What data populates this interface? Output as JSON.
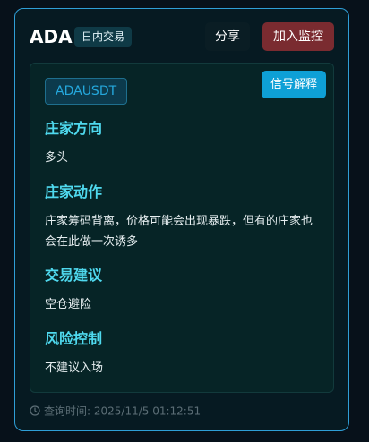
{
  "header": {
    "symbol": "ADA",
    "type_tag": "日内交易",
    "share_label": "分享",
    "monitor_label": "加入监控"
  },
  "panel": {
    "pair": "ADAUSDT",
    "explain_label": "信号解释",
    "sections": [
      {
        "title": "庄家方向",
        "body": "多头"
      },
      {
        "title": "庄家动作",
        "body": "庄家筹码背离，价格可能会出现暴跌，但有的庄家也会在此做一次诱多"
      },
      {
        "title": "交易建议",
        "body": "空仓避险"
      },
      {
        "title": "风险控制",
        "body": "不建议入场"
      }
    ]
  },
  "footer": {
    "query_time_label": "查询时间:",
    "query_time": "2025/11/5 01:12:51",
    "icon": "clock-icon"
  },
  "colors": {
    "accent": "#4fd9ee",
    "border": "#2f9ed6",
    "monitor_button": "#7a2b30",
    "explain_button": "#0ea0d6"
  }
}
